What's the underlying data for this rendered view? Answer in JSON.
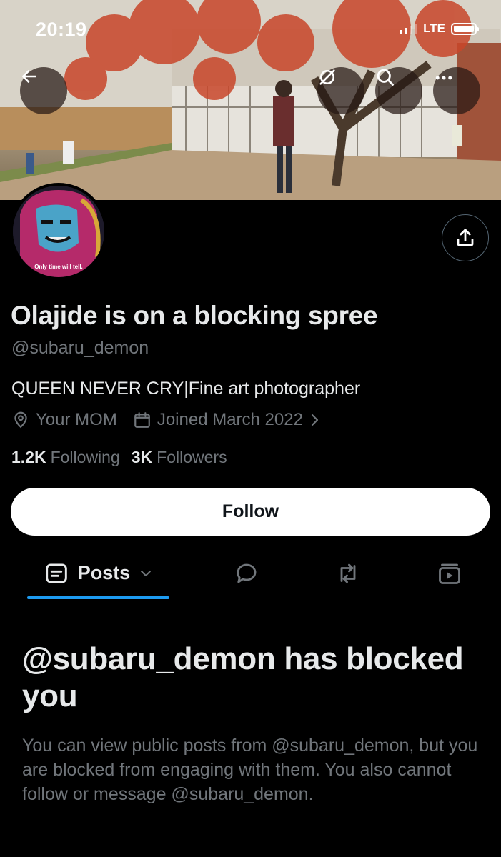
{
  "status_bar": {
    "time": "20:19",
    "network": "LTE",
    "battery_level": 1.0
  },
  "header": {
    "back_icon": "arrow-left-icon",
    "grok_icon": "grok-slash-icon",
    "search_icon": "search-icon",
    "more_icon": "more-dots-icon",
    "share_icon": "share-upload-icon"
  },
  "avatar": {
    "caption": "Only time will tell."
  },
  "profile": {
    "display_name": "Olajide is on a blocking spree",
    "handle": "@subaru_demon",
    "bio": "QUEEN NEVER CRY|Fine art photographer",
    "location": "Your MOM",
    "joined": "Joined March 2022",
    "following_count": "1.2K",
    "following_label": "Following",
    "followers_count": "3K",
    "followers_label": "Followers"
  },
  "follow_button": {
    "label": "Follow"
  },
  "tabs": {
    "posts_label": "Posts",
    "active": "posts",
    "accent_color": "#1d9bf0"
  },
  "blocked_notice": {
    "title": "@subaru_demon has blocked you",
    "body": "You can view public posts from @subaru_demon, but you are blocked from engaging with them. You also cannot follow or message @subaru_demon."
  },
  "colors": {
    "background": "#000000",
    "text_primary": "#e7e9ea",
    "text_secondary": "#71767b"
  }
}
